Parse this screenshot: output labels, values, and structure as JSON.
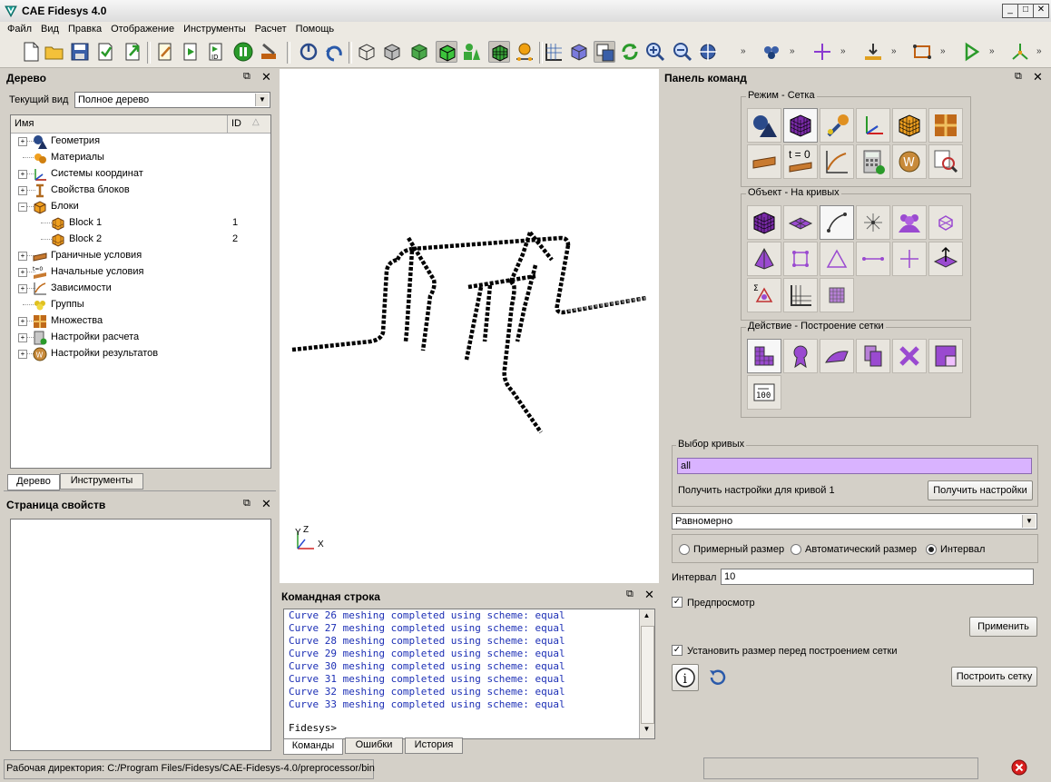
{
  "window": {
    "title": "CAE Fidesys 4.0",
    "btn_min": "_",
    "btn_max": "□",
    "btn_close": "✕"
  },
  "menu": [
    "Файл",
    "Вид",
    "Правка",
    "Отображение",
    "Инструменты",
    "Расчет",
    "Помощь"
  ],
  "toolbar": {
    "more": "»"
  },
  "tree_dock": {
    "title": "Дерево",
    "current_view_label": "Текущий вид",
    "current_view_value": "Полное дерево",
    "col_name": "Имя",
    "col_id": "ID",
    "items": [
      {
        "label": "Геометрия",
        "icon": "geometry-icon",
        "expander": "+",
        "indent": 0,
        "id": ""
      },
      {
        "label": "Материалы",
        "icon": "materials-icon",
        "expander": "",
        "indent": 0,
        "id": ""
      },
      {
        "label": "Системы координат",
        "icon": "coordinate-system-icon",
        "expander": "+",
        "indent": 0,
        "id": ""
      },
      {
        "label": "Свойства блоков",
        "icon": "block-properties-icon",
        "expander": "+",
        "indent": 0,
        "id": ""
      },
      {
        "label": "Блоки",
        "icon": "blocks-icon",
        "expander": "−",
        "indent": 0,
        "id": ""
      },
      {
        "label": "Block 1",
        "icon": "block-icon",
        "expander": "",
        "indent": 1,
        "id": "1"
      },
      {
        "label": "Block 2",
        "icon": "block-icon",
        "expander": "",
        "indent": 1,
        "id": "2"
      },
      {
        "label": "Граничные условия",
        "icon": "boundary-conditions-icon",
        "expander": "+",
        "indent": 0,
        "id": ""
      },
      {
        "label": "Начальные условия",
        "icon": "initial-conditions-icon",
        "expander": "+",
        "indent": 0,
        "id": ""
      },
      {
        "label": "Зависимости",
        "icon": "dependencies-icon",
        "expander": "+",
        "indent": 0,
        "id": ""
      },
      {
        "label": "Группы",
        "icon": "groups-icon",
        "expander": "",
        "indent": 0,
        "id": ""
      },
      {
        "label": "Множества",
        "icon": "sets-icon",
        "expander": "+",
        "indent": 0,
        "id": ""
      },
      {
        "label": "Настройки расчета",
        "icon": "calc-settings-icon",
        "expander": "+",
        "indent": 0,
        "id": ""
      },
      {
        "label": "Настройки результатов",
        "icon": "results-settings-icon",
        "expander": "+",
        "indent": 0,
        "id": ""
      }
    ],
    "tabs": [
      "Дерево",
      "Инструменты"
    ]
  },
  "props_dock": {
    "title": "Страница свойств"
  },
  "viewport": {
    "axis_x": "X",
    "axis_y": "Y",
    "axis_z": "Z"
  },
  "console": {
    "title": "Командная строка",
    "lines": [
      "Curve 26 meshing completed using scheme: equal",
      "Curve 27 meshing completed using scheme: equal",
      "Curve 28 meshing completed using scheme: equal",
      "Curve 29 meshing completed using scheme: equal",
      "Curve 30 meshing completed using scheme: equal",
      "Curve 31 meshing completed using scheme: equal",
      "Curve 32 meshing completed using scheme: equal",
      "Curve 33 meshing completed using scheme: equal"
    ],
    "prompt": "Fidesys>",
    "tabs": [
      "Команды",
      "Ошибки",
      "История"
    ]
  },
  "command_panel": {
    "title": "Панель команд",
    "group_mode": "Режим - Сетка",
    "group_object": "Объект - На кривых",
    "group_action": "Действие - Построение сетки",
    "t0_label": "t = 0",
    "curve_select_title": "Выбор кривых",
    "curve_select_value": "all",
    "get_settings_label": "Получить настройки для кривой 1",
    "get_settings_button": "Получить настройки",
    "scheme_value": "Равномерно",
    "radio_approx": "Примерный размер",
    "radio_auto": "Автоматический размер",
    "radio_interval": "Интервал",
    "interval_label": "Интервал",
    "interval_value": "10",
    "preview_label": "Предпросмотр",
    "apply_button": "Применить",
    "set_size_label": "Установить размер перед построением сетки",
    "build_mesh_button": "Построить сетку"
  },
  "status": {
    "workdir": "Рабочая директория: C:/Program Files/Fidesys/CAE-Fidesys-4.0/preprocessor/bin"
  }
}
